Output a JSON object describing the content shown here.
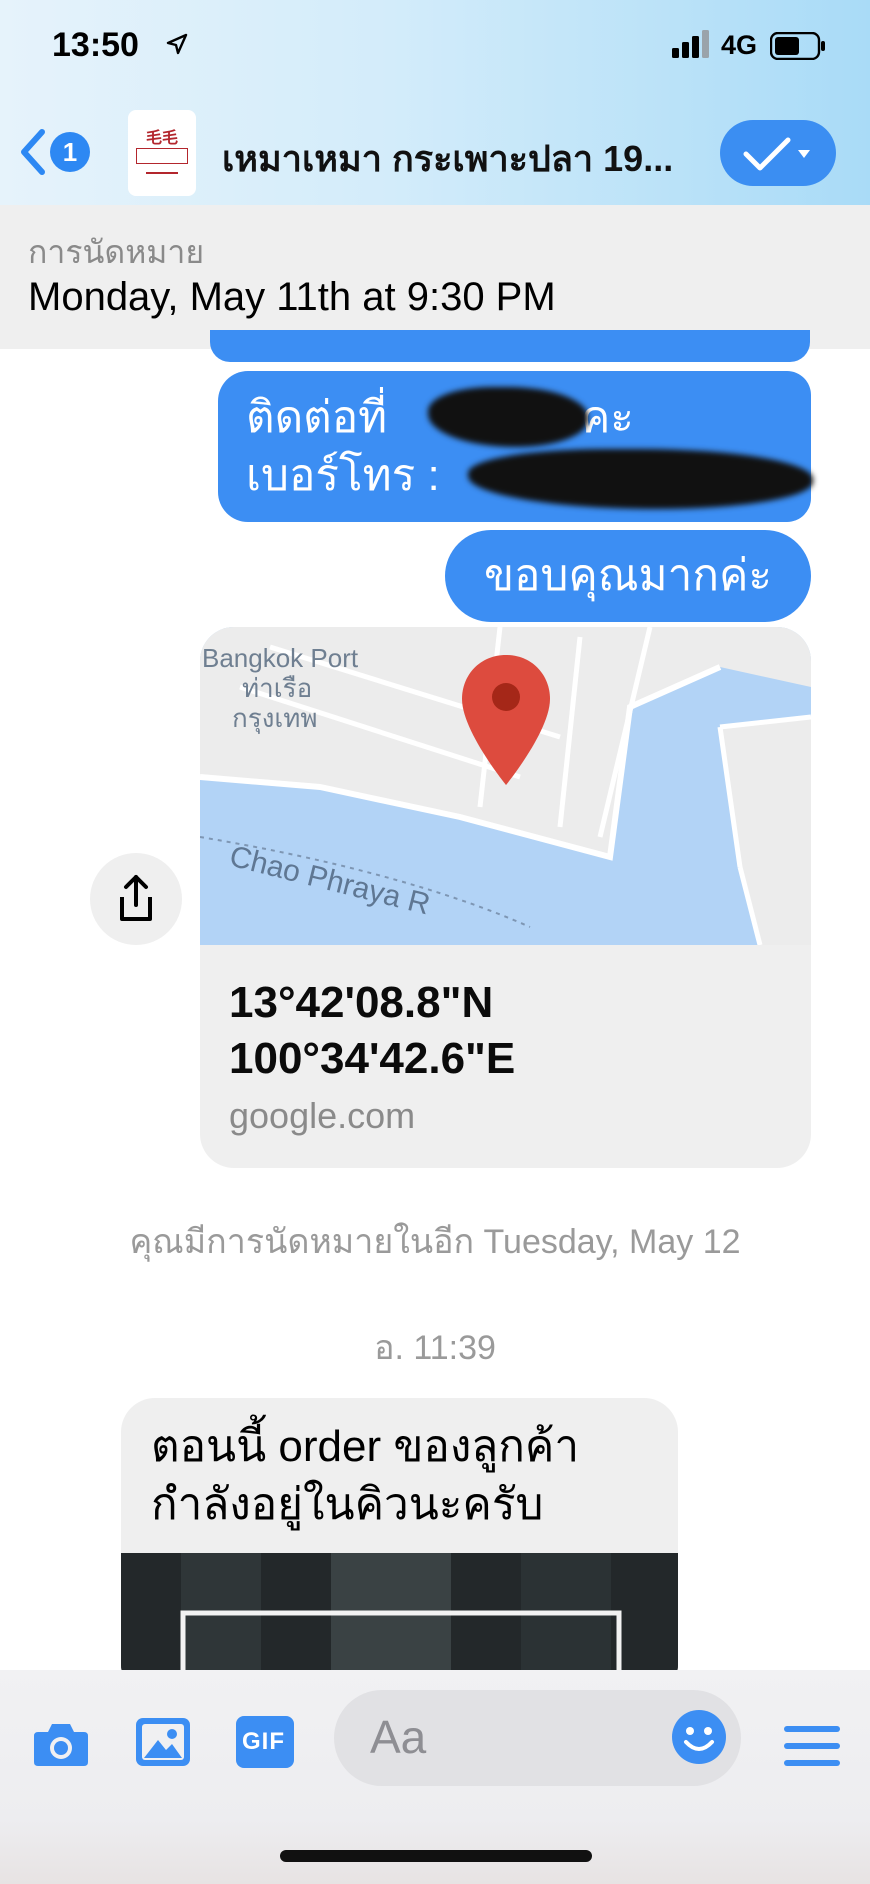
{
  "status_bar": {
    "time": "13:50",
    "network": "4G",
    "location_icon": "location-arrow-icon"
  },
  "header": {
    "unread_count": "1",
    "title": "เหมาเหมา กระเพาะปลา 19...",
    "avatar_top": "毛毛",
    "avatar_mid": "เหมา เหมา",
    "accent_color": "#3c8ef3"
  },
  "appointment_banner": {
    "label": "การนัดหมาย",
    "date": "Monday, May 11th at 9:30 PM"
  },
  "messages": {
    "outgoing_contact": {
      "line1": "ติดต่อที่",
      "line1_end": "นะคะ",
      "line2": "เบอร์โทร :"
    },
    "outgoing_thanks": "ขอบคุณมากค่ะ",
    "location_card": {
      "map_label_en": "Bangkok Port",
      "map_label_th1": "ท่าเรือ",
      "map_label_th2": "กรุงเทพ",
      "map_river_label": "Chao Phraya R",
      "lat": "13°42'08.8\"N",
      "lon": "100°34'42.6\"E",
      "link": "google.com"
    },
    "system_note": "คุณมีการนัดหมายในอีก Tuesday, May 12",
    "timestamp": "อ. 11:39",
    "incoming": {
      "line1": "ตอนนี้ order ของลูกค้า",
      "line2": "กำลังอยู่ในคิวนะครับ"
    }
  },
  "composer": {
    "placeholder": "Aa",
    "gif_label": "GIF"
  }
}
